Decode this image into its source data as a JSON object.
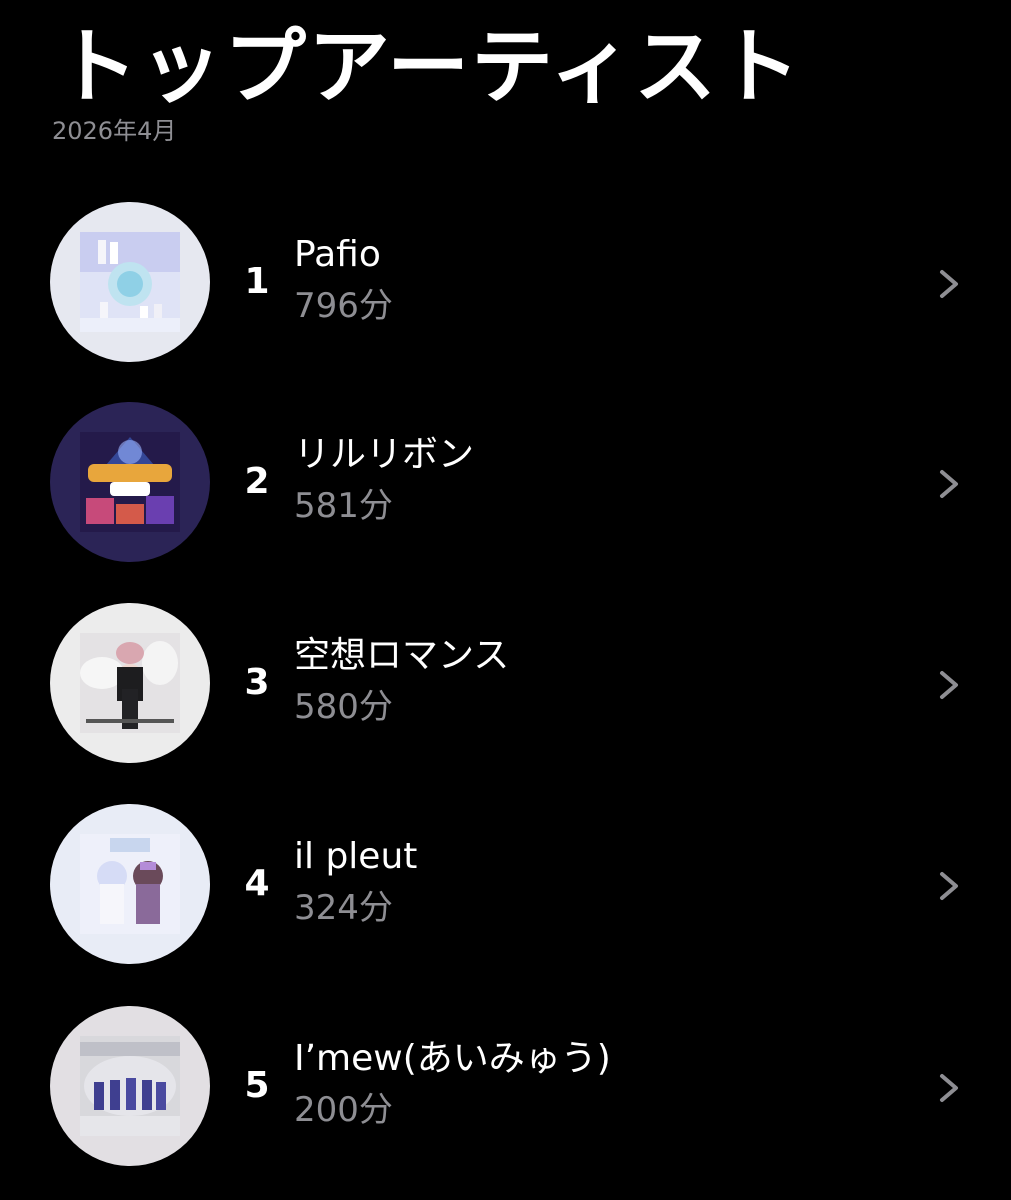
{
  "header": {
    "title": "トップアーティスト",
    "subtitle": "2026年4月"
  },
  "artists": [
    {
      "rank": "1",
      "name": "Pafio",
      "minutes": "796分"
    },
    {
      "rank": "2",
      "name": "リルリボン",
      "minutes": "581分"
    },
    {
      "rank": "3",
      "name": "空想ロマンス",
      "minutes": "580分"
    },
    {
      "rank": "4",
      "name": "il pleut",
      "minutes": "324分"
    },
    {
      "rank": "5",
      "name": "I’mew(あいみゅう)",
      "minutes": "200分"
    }
  ],
  "colors": {
    "background": "#000000",
    "primary_text": "#ffffff",
    "secondary_text": "#8e8e93",
    "chevron": "#8e8e93"
  },
  "icons": {
    "row_disclosure": "chevron-right-icon"
  }
}
